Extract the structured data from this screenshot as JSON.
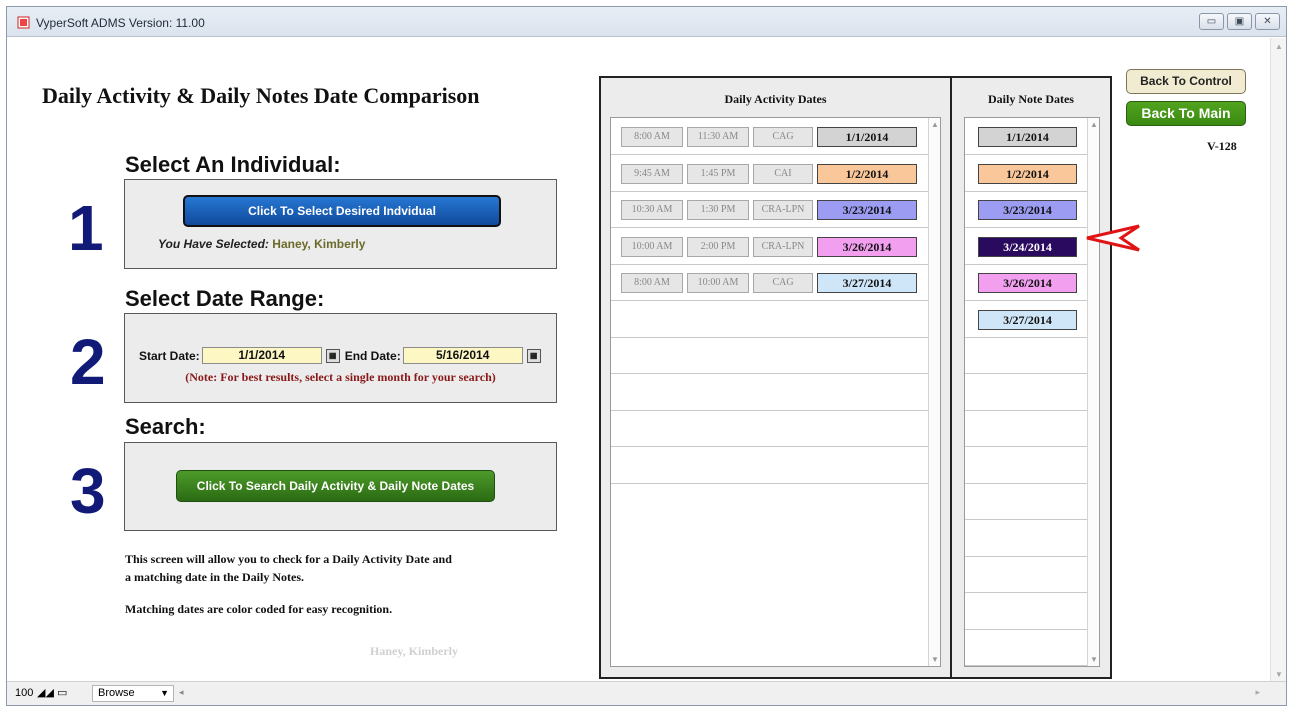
{
  "window": {
    "title": "VyperSoft ADMS Version: 11.00",
    "buttons": [
      "▭",
      "▣",
      "✕"
    ]
  },
  "page": {
    "title": "Daily Activity & Daily Notes Date Comparison",
    "step1": {
      "number": "1",
      "heading": "Select An Individual:",
      "button": "Click To Select Desired Indvidual",
      "selected_label": "You Have Selected:",
      "selected_value": "Haney, Kimberly"
    },
    "step2": {
      "number": "2",
      "heading": "Select Date Range:",
      "start_label": "Start Date:",
      "start_value": "1/1/2014",
      "end_label": "End Date:",
      "end_value": "5/16/2014",
      "note": "(Note: For best results, select a single month for your search)"
    },
    "step3": {
      "number": "3",
      "heading": "Search:",
      "button": "Click To Search Daily Activity & Daily Note Dates"
    },
    "description_line1": "This screen will allow you to check for a Daily Activity Date and",
    "description_line2": "a matching date in the Daily Notes.",
    "description_line3": "Matching dates are color coded for easy recognition.",
    "watermark_name": "Haney, Kimberly"
  },
  "activity_panel": {
    "title": "Daily Activity Dates",
    "rows": [
      {
        "start": "8:00 AM",
        "end": "11:30 AM",
        "type": "CAG",
        "date": "1/1/2014",
        "color": "#d3d3d3"
      },
      {
        "start": "9:45 AM",
        "end": "1:45 PM",
        "type": "CAI",
        "date": "1/2/2014",
        "color": "#f9c79a"
      },
      {
        "start": "10:30 AM",
        "end": "1:30 PM",
        "type": "CRA-LPN",
        "date": "3/23/2014",
        "color": "#9c9cf3"
      },
      {
        "start": "10:00 AM",
        "end": "2:00 PM",
        "type": "CRA-LPN",
        "date": "3/26/2014",
        "color": "#f29ff0"
      },
      {
        "start": "8:00 AM",
        "end": "10:00 AM",
        "type": "CAG",
        "date": "3/27/2014",
        "color": "#cfe6f8"
      }
    ]
  },
  "notes_panel": {
    "title": "Daily Note Dates",
    "rows": [
      {
        "date": "1/1/2014",
        "color": "#d3d3d3",
        "text_color": "#111111"
      },
      {
        "date": "1/2/2014",
        "color": "#f9c79a",
        "text_color": "#111111"
      },
      {
        "date": "3/23/2014",
        "color": "#9c9cf3",
        "text_color": "#111111"
      },
      {
        "date": "3/24/2014",
        "color": "#2a0a5e",
        "text_color": "#ffffff"
      },
      {
        "date": "3/26/2014",
        "color": "#f29ff0",
        "text_color": "#111111"
      },
      {
        "date": "3/27/2014",
        "color": "#cfe6f8",
        "text_color": "#111111"
      }
    ]
  },
  "right": {
    "back_to_control": "Back To Control",
    "back_to_main": "Back To Main",
    "version": "V-128"
  },
  "status": {
    "zoom": "100",
    "mode": "Browse"
  },
  "icons": {
    "pointer": "red-arrow-icon",
    "calendar": "calendar-icon"
  }
}
